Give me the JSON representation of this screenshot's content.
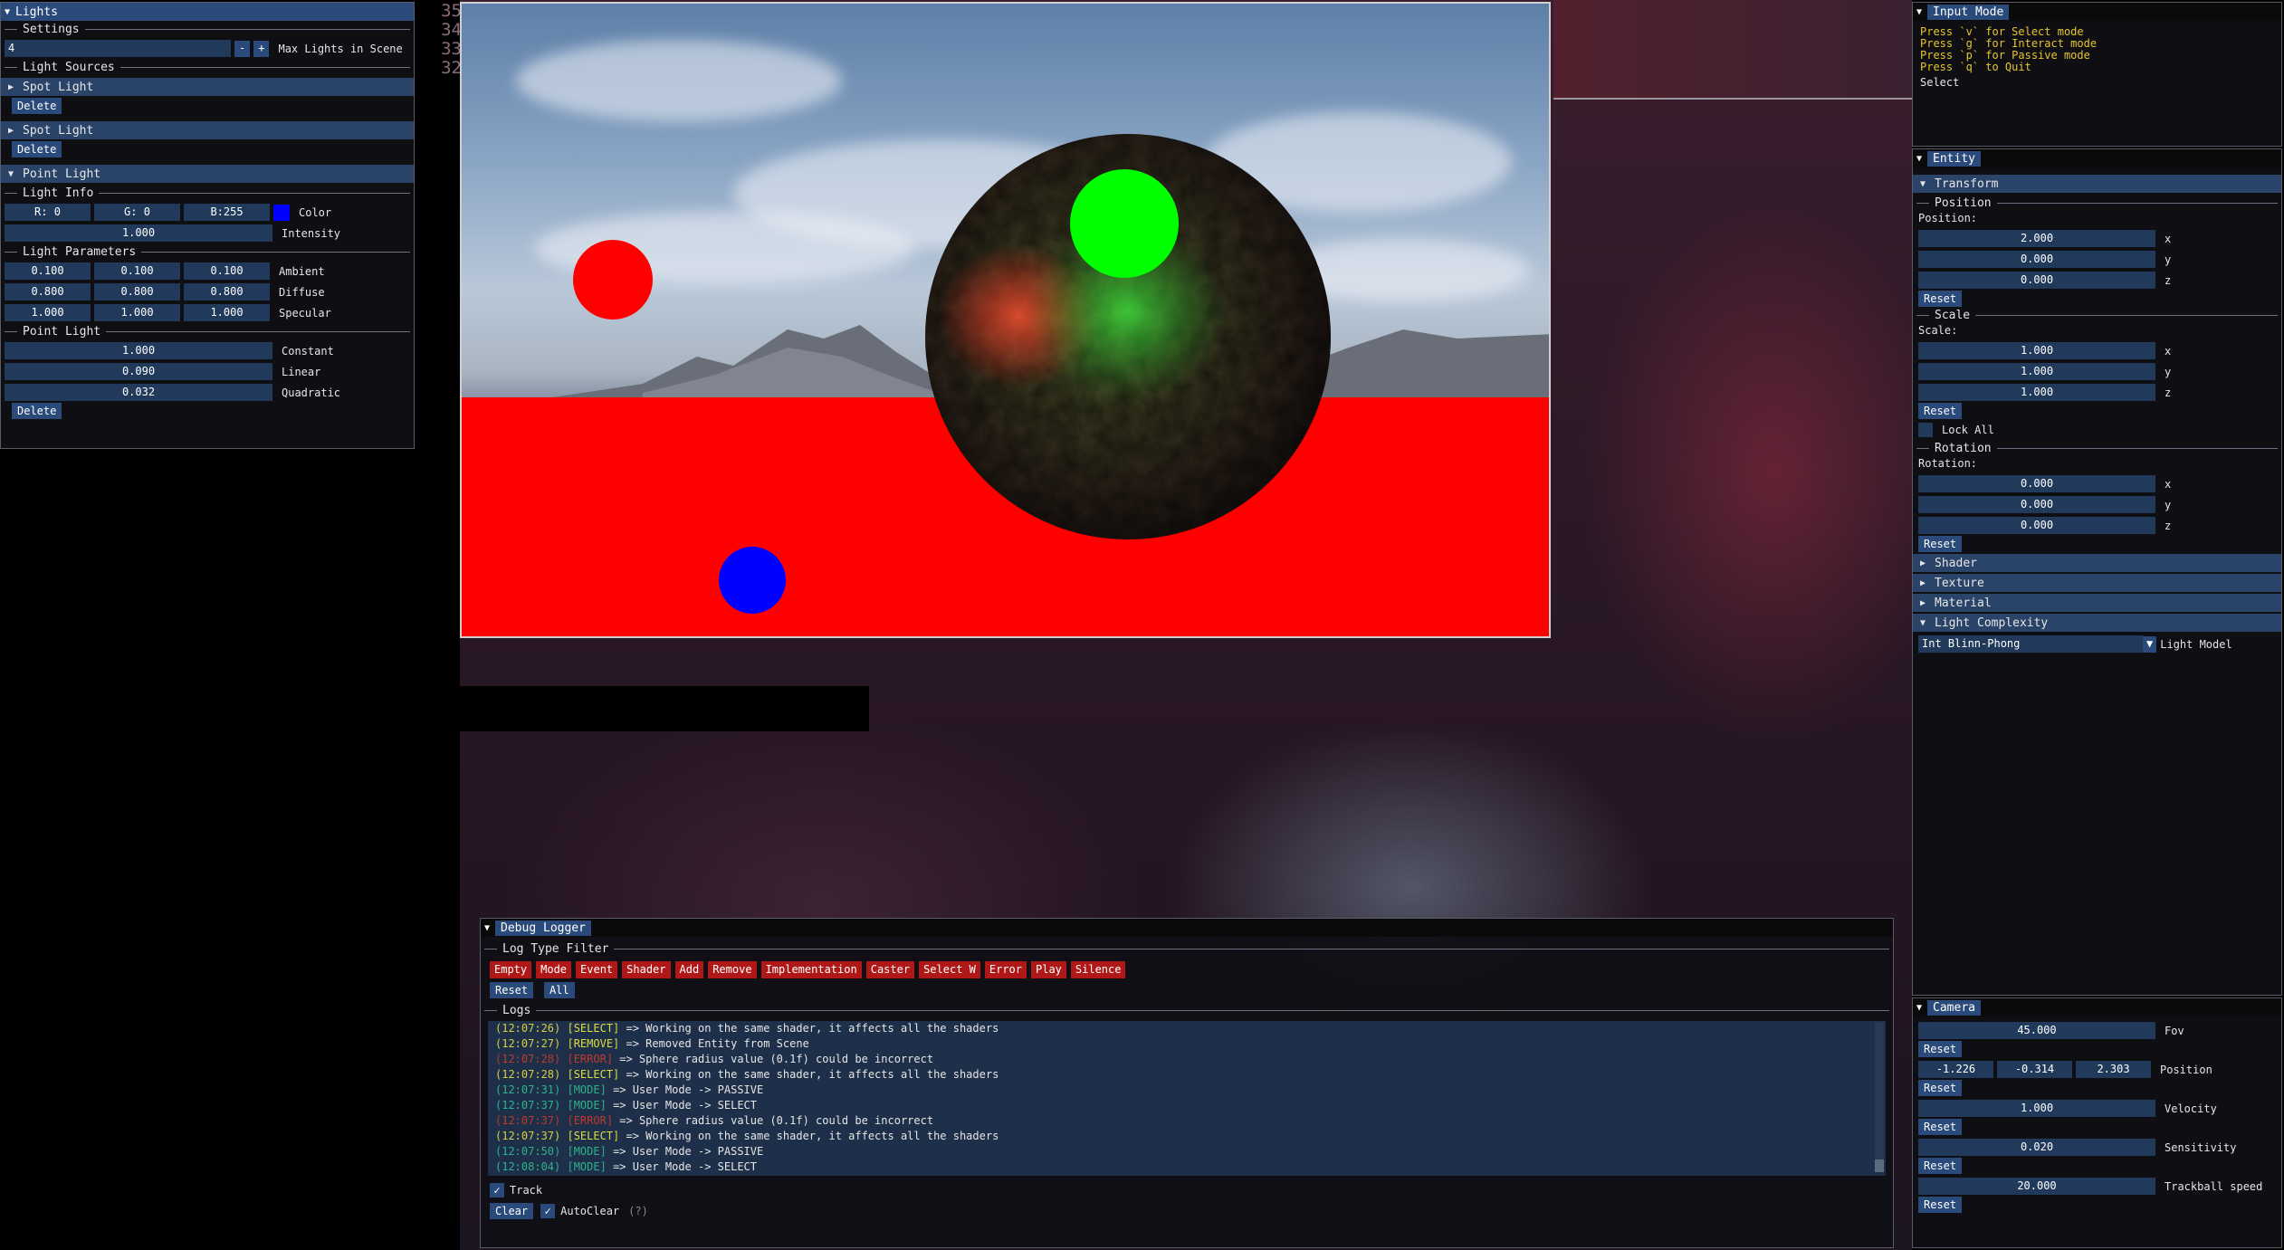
{
  "lights_panel": {
    "title": "Lights",
    "settings_header": "Settings",
    "max_lights_value": "4",
    "minus": "-",
    "plus": "+",
    "max_lights_label": "Max Lights in Scene",
    "light_sources_header": "Light Sources",
    "spot1": "Spot Light",
    "delete1": "Delete",
    "spot2": "Spot Light",
    "delete2": "Delete",
    "point": "Point Light",
    "light_info": "Light Info",
    "r": "R:  0",
    "g": "G:  0",
    "b": "B:255",
    "color_label": "Color",
    "color_swatch": "#0000ff",
    "intensity_value": "1.000",
    "intensity_label": "Intensity",
    "light_params": "Light Parameters",
    "ambient": [
      "0.100",
      "0.100",
      "0.100"
    ],
    "ambient_label": "Ambient",
    "diffuse": [
      "0.800",
      "0.800",
      "0.800"
    ],
    "diffuse_label": "Diffuse",
    "specular": [
      "1.000",
      "1.000",
      "1.000"
    ],
    "specular_label": "Specular",
    "point_light_sep": "Point Light",
    "constant": "1.000",
    "constant_label": "Constant",
    "linear": "0.090",
    "linear_label": "Linear",
    "quadratic": "0.032",
    "quadratic_label": "Quadratic",
    "delete3": "Delete"
  },
  "line_numbers": [
    "35",
    "34",
    "33",
    "32"
  ],
  "input_mode": {
    "title": "Input Mode",
    "lines": [
      "Press `v` for Select mode",
      "Press `g` for Interact mode",
      "Press `p` for Passive mode",
      "Press `q` to Quit"
    ],
    "current": "Select"
  },
  "entity": {
    "title": "Entity",
    "transform": "Transform",
    "position_sep": "Position",
    "position_label": "Position:",
    "position": [
      {
        "v": "2.000",
        "a": "x"
      },
      {
        "v": "0.000",
        "a": "y"
      },
      {
        "v": "0.000",
        "a": "z"
      }
    ],
    "reset1": "Reset",
    "scale_sep": "Scale",
    "scale_label": "Scale:",
    "scale": [
      {
        "v": "1.000",
        "a": "x"
      },
      {
        "v": "1.000",
        "a": "y"
      },
      {
        "v": "1.000",
        "a": "z"
      }
    ],
    "reset2": "Reset",
    "lock_all": "Lock All",
    "rotation_sep": "Rotation",
    "rotation_label": "Rotation:",
    "rotation": [
      {
        "v": "0.000",
        "a": "x"
      },
      {
        "v": "0.000",
        "a": "y"
      },
      {
        "v": "0.000",
        "a": "z"
      }
    ],
    "reset3": "Reset",
    "shader": "Shader",
    "texture": "Texture",
    "material": "Material",
    "light_complexity": "Light Complexity",
    "light_model_value": "Int Blinn-Phong",
    "light_model_label": "Light Model"
  },
  "camera": {
    "title": "Camera",
    "fov": "45.000",
    "fov_label": "Fov",
    "reset1": "Reset",
    "pos": [
      "-1.226",
      "-0.314",
      "2.303"
    ],
    "pos_label": "Position",
    "reset2": "Reset",
    "velocity": "1.000",
    "velocity_label": "Velocity",
    "reset3": "Reset",
    "sensitivity": "0.020",
    "sensitivity_label": "Sensitivity",
    "reset4": "Reset",
    "trackball": "20.000",
    "trackball_label": "Trackball speed",
    "reset5": "Reset"
  },
  "logger": {
    "title": "Debug Logger",
    "filter_header": "Log Type Filter",
    "filters": [
      "Empty",
      "Mode",
      "Event",
      "Shader",
      "Add",
      "Remove",
      "Implementation",
      "Caster",
      "Select W",
      "Error",
      "Play",
      "Silence"
    ],
    "reset": "Reset",
    "all": "All",
    "logs_header": "Logs",
    "entries": [
      {
        "t": "(12:07:26)",
        "tag": "[SELECT]",
        "c": "sel",
        "msg": " => Working on the same shader, it affects all the shaders"
      },
      {
        "t": "(12:07:27)",
        "tag": "[REMOVE]",
        "c": "rem",
        "msg": " => Removed Entity from Scene"
      },
      {
        "t": "(12:07:28)",
        "tag": "[ERROR]",
        "c": "err",
        "msg": " => Sphere radius value (0.1f) could be incorrect"
      },
      {
        "t": "(12:07:28)",
        "tag": "[SELECT]",
        "c": "sel",
        "msg": " => Working on the same shader, it affects all the shaders"
      },
      {
        "t": "(12:07:31)",
        "tag": "[MODE]",
        "c": "mode",
        "msg": " => User Mode -> PASSIVE"
      },
      {
        "t": "(12:07:37)",
        "tag": "[MODE]",
        "c": "mode",
        "msg": " => User Mode -> SELECT"
      },
      {
        "t": "(12:07:37)",
        "tag": "[ERROR]",
        "c": "err",
        "msg": " => Sphere radius value (0.1f) could be incorrect"
      },
      {
        "t": "(12:07:37)",
        "tag": "[SELECT]",
        "c": "sel",
        "msg": " => Working on the same shader, it affects all the shaders"
      },
      {
        "t": "(12:07:50)",
        "tag": "[MODE]",
        "c": "mode",
        "msg": " => User Mode -> PASSIVE"
      },
      {
        "t": "(12:08:04)",
        "tag": "[MODE]",
        "c": "mode",
        "msg": " => User Mode -> SELECT"
      }
    ],
    "track": "Track",
    "clear": "Clear",
    "autoclear": "AutoClear",
    "help": "(?)"
  }
}
